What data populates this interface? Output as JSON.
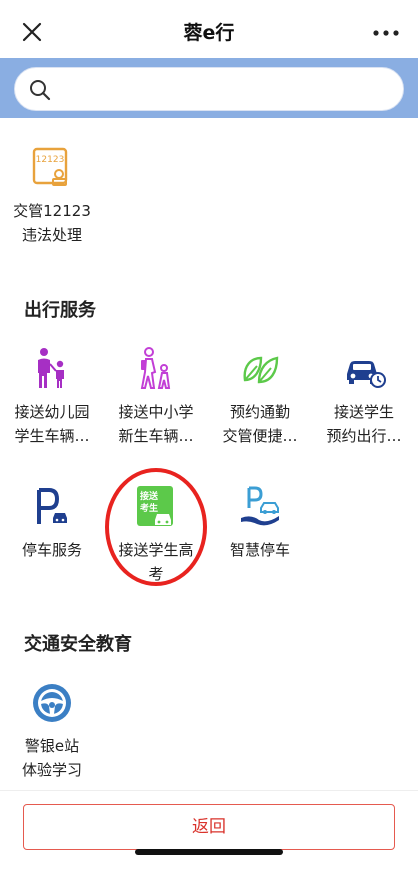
{
  "nav": {
    "title": "蓉e行",
    "close_icon": "close-icon",
    "more_icon": "more-dots-icon"
  },
  "search": {
    "placeholder": "",
    "value": "",
    "icon": "search-icon"
  },
  "top_items": [
    {
      "icon": "traffic-12123-icon",
      "label": "交管12123\n违法处理"
    }
  ],
  "travel_section": {
    "title": "出行服务",
    "items": [
      {
        "icon": "parent-child-walk-icon",
        "label": "接送幼儿园\n学生车辆…"
      },
      {
        "icon": "student-walk-icon",
        "label": "接送中小学\n新生车辆…"
      },
      {
        "icon": "leaf-icon",
        "label": "预约通勤\n交管便捷…"
      },
      {
        "icon": "car-clock-icon",
        "label": "接送学生\n预约出行…"
      },
      {
        "icon": "parking-icon",
        "label": "停车服务"
      },
      {
        "icon": "exam-shuttle-icon",
        "label": "接送学生高\n考"
      },
      {
        "icon": "smart-parking-icon",
        "label": "智慧停车"
      }
    ]
  },
  "safety_section": {
    "title": "交通安全教育",
    "items": [
      {
        "icon": "steering-wheel-icon",
        "label": "警银e站\n体验学习"
      }
    ]
  },
  "footer": {
    "back_label": "返回"
  },
  "colors": {
    "search_band": "#8aaee2",
    "accent_red": "#d9322b",
    "highlight_ring": "#e8231f",
    "icon_purple": "#a62fc4",
    "icon_green": "#5cc94a",
    "icon_navy": "#1f3f8f",
    "icon_orange": "#e8a23c",
    "icon_blue": "#3b7fc4"
  }
}
